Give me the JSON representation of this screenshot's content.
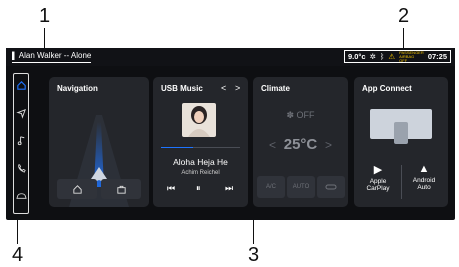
{
  "callouts": {
    "c1": "1",
    "c2": "2",
    "c3": "3",
    "c4": "4"
  },
  "status": {
    "now_playing": "Alan Walker -- Alone",
    "temperature": "9.0°c",
    "airbag_label": "PASSENGER AIRBAG",
    "airbag_state": "OFF",
    "time": "07:25"
  },
  "sidebar": [
    "home-icon",
    "navigation-arrow-icon",
    "music-note-icon",
    "phone-icon",
    "car-icon"
  ],
  "navigation": {
    "title": "Navigation"
  },
  "music": {
    "title": "USB Music",
    "prev_arrow": "<",
    "next_arrow": ">",
    "song": "Aloha Heja He",
    "artist": "Achim Reichel"
  },
  "climate": {
    "title": "Climate",
    "fan_state": "OFF",
    "temp": "25°C",
    "dec": "<",
    "inc": ">",
    "buttons": [
      "A/C",
      "AUTO"
    ]
  },
  "app_connect": {
    "title": "App Connect",
    "carplay_label": "Apple\nCarPlay",
    "android_label": "Android\nAuto"
  },
  "colors": {
    "screen": "#0e0f12",
    "card": "#24262b",
    "accent_blue": "#1e74ff"
  }
}
